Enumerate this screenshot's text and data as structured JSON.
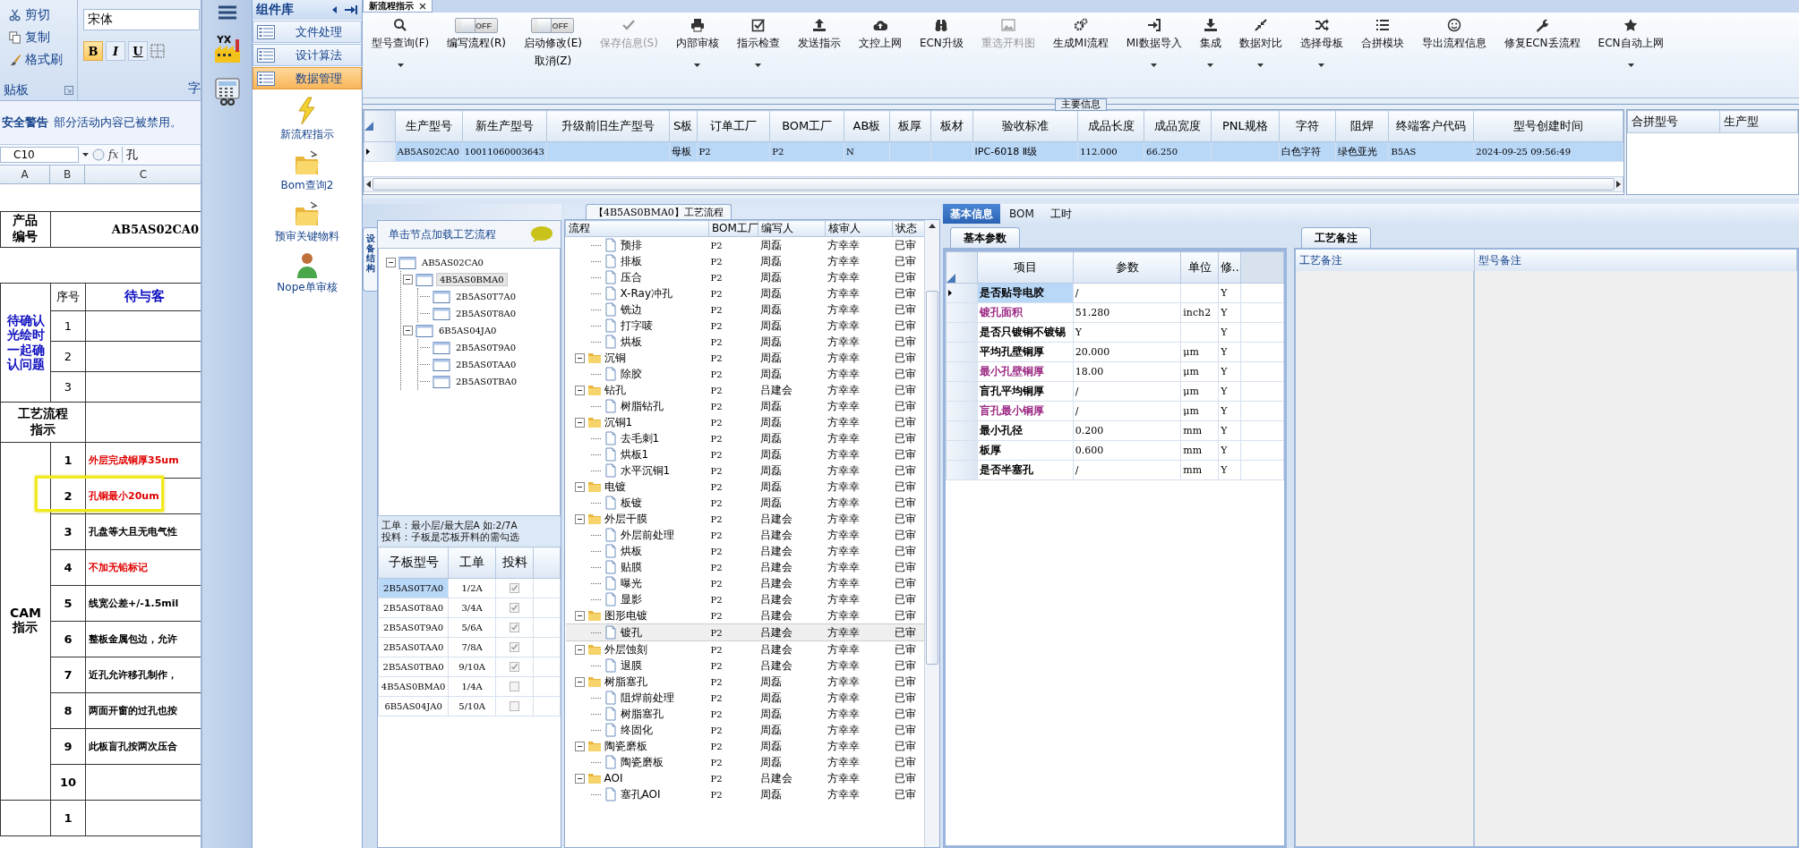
{
  "excel": {
    "clipboard": {
      "items": [
        "剪切",
        "复制",
        "格式刷"
      ],
      "label": "贴板"
    },
    "font": {
      "name": "宋体",
      "format_buttons": [
        "B",
        "I",
        "U"
      ],
      "label": "字"
    },
    "security": {
      "title": "安全警告",
      "message": "部分活动内容已被禁用。"
    },
    "name_box": "C10",
    "fx": "fx",
    "formula": "孔",
    "columns": [
      "A",
      "B",
      "C"
    ],
    "product": {
      "label": "产品编号",
      "value": "AB5AS02CA0"
    },
    "confirm": {
      "label": "待确认光绘时一起确认问题",
      "seq_header": "序号",
      "content_header": "待与客",
      "numbers": [
        "1",
        "2",
        "3"
      ]
    },
    "process_label": "工艺流程指示",
    "cam": {
      "label": "CAM指示",
      "items": [
        {
          "no": "1",
          "text": "外层完成铜厚35um",
          "emphasis": true,
          "highlighted": false
        },
        {
          "no": "2",
          "text": "孔铜最小20um",
          "emphasis": true,
          "highlighted": true
        },
        {
          "no": "3",
          "text": "孔盘等大且无电气性",
          "emphasis": false,
          "highlighted": false
        },
        {
          "no": "4",
          "text": "不加无铅标记",
          "emphasis": true,
          "highlighted": false
        },
        {
          "no": "5",
          "text": "线宽公差+/-1.5mil",
          "emphasis": false,
          "highlighted": false
        },
        {
          "no": "6",
          "text": "整板金属包边，允许",
          "emphasis": false,
          "highlighted": false
        },
        {
          "no": "7",
          "text": "近孔允许移孔制作，",
          "emphasis": false,
          "highlighted": false
        },
        {
          "no": "8",
          "text": "两面开窗的过孔也按",
          "emphasis": false,
          "highlighted": false
        },
        {
          "no": "9",
          "text": "此板盲孔按两次压合",
          "emphasis": false,
          "highlighted": false
        },
        {
          "no": "10",
          "highlighted": false
        }
      ]
    },
    "next_numbers": [
      "1"
    ]
  },
  "library": {
    "title": "组件库",
    "categories": [
      {
        "label": "文件处理",
        "selected": false
      },
      {
        "label": "设计算法",
        "selected": false
      },
      {
        "label": "数据管理",
        "selected": true
      }
    ],
    "tools": [
      "新流程指示",
      "Bom查询2",
      "预审关键物料",
      "Nope单审核"
    ]
  },
  "document_tab": {
    "title": "新流程指示"
  },
  "toolbar": [
    {
      "kind": "button",
      "label": "型号查询(F)",
      "dropdown": true,
      "disabled": false
    },
    {
      "kind": "toggle",
      "label": "编写流程(R)",
      "on": false,
      "state_text": "OFF"
    },
    {
      "kind": "toggle",
      "label": "启动修改(E)",
      "sublabel": "取消(Z)",
      "on": false,
      "state_text": "OFF"
    },
    {
      "kind": "button",
      "label": "保存信息(S)",
      "dropdown": false,
      "disabled": true
    },
    {
      "kind": "button",
      "label": "内部审核",
      "dropdown": true,
      "disabled": false
    },
    {
      "kind": "button",
      "label": "指示检查",
      "dropdown": true,
      "disabled": false
    },
    {
      "kind": "button",
      "label": "发送指示",
      "dropdown": false,
      "disabled": false
    },
    {
      "kind": "button",
      "label": "文控上网",
      "dropdown": false,
      "disabled": false
    },
    {
      "kind": "button",
      "label": "ECN升级",
      "dropdown": false,
      "disabled": false
    },
    {
      "kind": "button",
      "label": "重选开料图",
      "dropdown": false,
      "disabled": true
    },
    {
      "kind": "button",
      "label": "生成MI流程",
      "dropdown": false,
      "disabled": false
    },
    {
      "kind": "button",
      "label": "MI数据导入",
      "dropdown": true,
      "disabled": false
    },
    {
      "kind": "button",
      "label": "集成",
      "dropdown": true,
      "disabled": false
    },
    {
      "kind": "button",
      "label": "数据对比",
      "dropdown": true,
      "disabled": false
    },
    {
      "kind": "button",
      "label": "选择母板",
      "dropdown": true,
      "disabled": false
    },
    {
      "kind": "button",
      "label": "合拼模块",
      "dropdown": false,
      "disabled": false
    },
    {
      "kind": "button",
      "label": "导出流程信息",
      "dropdown": false,
      "disabled": false
    },
    {
      "kind": "button",
      "label": "修复ECN丢流程",
      "dropdown": false,
      "disabled": false
    },
    {
      "kind": "button",
      "label": "ECN自动上网",
      "dropdown": true,
      "disabled": false
    }
  ],
  "main_info": {
    "legend": "主要信息",
    "columns": [
      "生产型号",
      "新生产型号",
      "升级前旧生产型号",
      "S板",
      "订单工厂",
      "BOM工厂",
      "AB板",
      "板厚",
      "板材",
      "验收标准",
      "成品长度",
      "成品宽度",
      "PNL规格",
      "字符",
      "阻焊",
      "终端客户代码",
      "型号创建时间"
    ],
    "rows": [
      {
        "selected": true,
        "cells": [
          "AB5AS02CA0",
          "10011060003643",
          null,
          "母板",
          "P2",
          "P2",
          "N",
          null,
          null,
          "IPC-6018 Ⅱ级",
          "112.000",
          "66.250",
          null,
          "白色字符",
          "绿色亚光",
          "B5AS",
          "2024-09-25 09:56:49"
        ]
      }
    ],
    "side_columns": [
      "合拼型号",
      "生产型"
    ]
  },
  "structure": {
    "tab": "设备结构",
    "hint": "单击节点加载工艺流程",
    "tree": [
      {
        "label": "AB5AS02CA0",
        "expanded": true,
        "selected": false,
        "children": [
          {
            "label": "4B5AS0BMA0",
            "expanded": true,
            "selected": true,
            "children": [
              {
                "label": "2B5AS0T7A0",
                "selected": false
              },
              {
                "label": "2B5AS0T8A0",
                "selected": false
              }
            ]
          },
          {
            "label": "6B5AS04JA0",
            "expanded": true,
            "selected": false,
            "children": [
              {
                "label": "2B5AS0T9A0",
                "selected": false
              },
              {
                "label": "2B5AS0TAA0",
                "selected": false
              },
              {
                "label": "2B5AS0TBA0",
                "selected": false
              }
            ]
          }
        ]
      }
    ],
    "notes": [
      "工单：最小层/最大层A 如:2/7A",
      "投料：子板是芯板开料的需勾选"
    ],
    "columns": [
      "子板型号",
      "工单",
      "投料"
    ],
    "rows": [
      {
        "board": "2B5AS0T7A0",
        "order": "1/2A",
        "checked": true,
        "selected": true
      },
      {
        "board": "2B5AS0T8A0",
        "order": "3/4A",
        "checked": true,
        "selected": false
      },
      {
        "board": "2B5AS0T9A0",
        "order": "5/6A",
        "checked": true,
        "selected": false
      },
      {
        "board": "2B5AS0TAA0",
        "order": "7/8A",
        "checked": true,
        "selected": false
      },
      {
        "board": "2B5AS0TBA0",
        "order": "9/10A",
        "checked": true,
        "selected": false
      },
      {
        "board": "4B5AS0BMA0",
        "order": "1/4A",
        "checked": false,
        "selected": false
      },
      {
        "board": "6B5AS04JA0",
        "order": "5/10A",
        "checked": false,
        "selected": false
      }
    ]
  },
  "process": {
    "title": "【4B5AS0BMA0】工艺流程",
    "columns": [
      "流程",
      "BOM工厂",
      "编写人",
      "核审人",
      "状态"
    ],
    "groups": [
      {
        "children": [
          {
            "label": "预排",
            "bom": "P2",
            "writer": "周磊",
            "reviewer": "方幸幸",
            "status": "已审",
            "selected": false
          },
          {
            "label": "排板",
            "bom": "P2",
            "writer": "周磊",
            "reviewer": "方幸幸",
            "status": "已审",
            "selected": false
          },
          {
            "label": "压合",
            "bom": "P2",
            "writer": "周磊",
            "reviewer": "方幸幸",
            "status": "已审",
            "selected": false
          },
          {
            "label": "X-Ray冲孔",
            "bom": "P2",
            "writer": "周磊",
            "reviewer": "方幸幸",
            "status": "已审",
            "selected": false
          },
          {
            "label": "铣边",
            "bom": "P2",
            "writer": "周磊",
            "reviewer": "方幸幸",
            "status": "已审",
            "selected": false
          },
          {
            "label": "打字唛",
            "bom": "P2",
            "writer": "周磊",
            "reviewer": "方幸幸",
            "status": "已审",
            "selected": false
          },
          {
            "label": "烘板",
            "bom": "P2",
            "writer": "周磊",
            "reviewer": "方幸幸",
            "status": "已审",
            "selected": false
          }
        ]
      },
      {
        "label": "沉铜",
        "bom": "P2",
        "writer": "周磊",
        "reviewer": "方幸幸",
        "status": "已审",
        "selected": false,
        "expanded": true,
        "children": [
          {
            "label": "除胶",
            "bom": "P2",
            "writer": "周磊",
            "reviewer": "方幸幸",
            "status": "已审",
            "selected": false
          }
        ]
      },
      {
        "label": "钻孔",
        "bom": "P2",
        "writer": "吕建会",
        "reviewer": "方幸幸",
        "status": "已审",
        "selected": false,
        "expanded": true,
        "children": [
          {
            "label": "树脂钻孔",
            "bom": "P2",
            "writer": "周磊",
            "reviewer": "方幸幸",
            "status": "已审",
            "selected": false
          }
        ]
      },
      {
        "label": "沉铜1",
        "bom": "P2",
        "writer": "周磊",
        "reviewer": "方幸幸",
        "status": "已审",
        "selected": false,
        "expanded": true,
        "children": [
          {
            "label": "去毛刺1",
            "bom": "P2",
            "writer": "周磊",
            "reviewer": "方幸幸",
            "status": "已审",
            "selected": false
          },
          {
            "label": "烘板1",
            "bom": "P2",
            "writer": "周磊",
            "reviewer": "方幸幸",
            "status": "已审",
            "selected": false
          },
          {
            "label": "水平沉铜1",
            "bom": "P2",
            "writer": "周磊",
            "reviewer": "方幸幸",
            "status": "已审",
            "selected": false
          }
        ]
      },
      {
        "label": "电镀",
        "bom": "P2",
        "writer": "周磊",
        "reviewer": "方幸幸",
        "status": "已审",
        "selected": false,
        "expanded": true,
        "children": [
          {
            "label": "板镀",
            "bom": "P2",
            "writer": "周磊",
            "reviewer": "方幸幸",
            "status": "已审",
            "selected": false
          }
        ]
      },
      {
        "label": "外层干膜",
        "bom": "P2",
        "writer": "吕建会",
        "reviewer": "方幸幸",
        "status": "已审",
        "selected": false,
        "expanded": true,
        "children": [
          {
            "label": "外层前处理",
            "bom": "P2",
            "writer": "吕建会",
            "reviewer": "方幸幸",
            "status": "已审",
            "selected": false
          },
          {
            "label": "烘板",
            "bom": "P2",
            "writer": "吕建会",
            "reviewer": "方幸幸",
            "status": "已审",
            "selected": false
          },
          {
            "label": "贴膜",
            "bom": "P2",
            "writer": "吕建会",
            "reviewer": "方幸幸",
            "status": "已审",
            "selected": false
          },
          {
            "label": "曝光",
            "bom": "P2",
            "writer": "吕建会",
            "reviewer": "方幸幸",
            "status": "已审",
            "selected": false
          },
          {
            "label": "显影",
            "bom": "P2",
            "writer": "吕建会",
            "reviewer": "方幸幸",
            "status": "已审",
            "selected": false
          }
        ]
      },
      {
        "label": "图形电镀",
        "bom": "P2",
        "writer": "吕建会",
        "reviewer": "方幸幸",
        "status": "已审",
        "selected": false,
        "expanded": true,
        "children": [
          {
            "label": "镀孔",
            "bom": "P2",
            "writer": "吕建会",
            "reviewer": "方幸幸",
            "status": "已审",
            "selected": true
          }
        ]
      },
      {
        "label": "外层蚀刻",
        "bom": "P2",
        "writer": "吕建会",
        "reviewer": "方幸幸",
        "status": "已审",
        "selected": false,
        "expanded": true,
        "children": [
          {
            "label": "退膜",
            "bom": "P2",
            "writer": "吕建会",
            "reviewer": "方幸幸",
            "status": "已审",
            "selected": false
          }
        ]
      },
      {
        "label": "树脂塞孔",
        "bom": "P2",
        "writer": "周磊",
        "reviewer": "方幸幸",
        "status": "已审",
        "selected": false,
        "expanded": true,
        "children": [
          {
            "label": "阻焊前处理",
            "bom": "P2",
            "writer": "周磊",
            "reviewer": "方幸幸",
            "status": "已审",
            "selected": false
          },
          {
            "label": "树脂塞孔",
            "bom": "P2",
            "writer": "周磊",
            "reviewer": "方幸幸",
            "status": "已审",
            "selected": false
          },
          {
            "label": "终固化",
            "bom": "P2",
            "writer": "周磊",
            "reviewer": "方幸幸",
            "status": "已审",
            "selected": false
          }
        ]
      },
      {
        "label": "陶瓷磨板",
        "bom": "P2",
        "writer": "周磊",
        "reviewer": "方幸幸",
        "status": "已审",
        "selected": false,
        "expanded": true,
        "children": [
          {
            "label": "陶瓷磨板",
            "bom": "P2",
            "writer": "周磊",
            "reviewer": "方幸幸",
            "status": "已审",
            "selected": false
          }
        ]
      },
      {
        "label": "AOI",
        "bom": "P2",
        "writer": "吕建会",
        "reviewer": "方幸幸",
        "status": "已审",
        "selected": false,
        "expanded": true,
        "children": [
          {
            "label": "塞孔AOI",
            "bom": "P2",
            "writer": "周磊",
            "reviewer": "方幸幸",
            "status": "已审",
            "selected": false
          }
        ]
      }
    ]
  },
  "details": {
    "tabs": [
      {
        "label": "基本信息",
        "selected": true
      },
      {
        "label": "BOM",
        "selected": false
      },
      {
        "label": "工时",
        "selected": false
      }
    ],
    "params_tab": "基本参数",
    "columns": [
      "项目",
      "参数",
      "单位",
      "修.."
    ],
    "rows": [
      {
        "item": "是否贴导电胶",
        "value": "/",
        "flag": "Y",
        "color": "#000000",
        "selected": true
      },
      {
        "item": "镀孔面积",
        "value": "51.280",
        "unit": "inch2",
        "flag": "Y",
        "color": "#9c2a84",
        "selected": false
      },
      {
        "item": "是否只镀铜不镀锡",
        "value": "Y",
        "flag": "Y",
        "color": "#000000",
        "selected": false
      },
      {
        "item": "平均孔壁铜厚",
        "value": "20.000",
        "unit": "μm",
        "flag": "Y",
        "color": "#000000",
        "selected": false
      },
      {
        "item": "最小孔壁铜厚",
        "value": "18.00",
        "unit": "μm",
        "flag": "Y",
        "color": "#9c2a84",
        "selected": false
      },
      {
        "item": "盲孔平均铜厚",
        "value": "/",
        "unit": "μm",
        "flag": "Y",
        "color": "#000000",
        "selected": false
      },
      {
        "item": "盲孔最小铜厚",
        "value": "/",
        "unit": "μm",
        "flag": "Y",
        "color": "#9c2a84",
        "selected": false
      },
      {
        "item": "最小孔径",
        "value": "0.200",
        "unit": "mm",
        "flag": "Y",
        "color": "#000000",
        "selected": false
      },
      {
        "item": "板厚",
        "value": "0.600",
        "unit": "mm",
        "flag": "Y",
        "color": "#000000",
        "selected": false
      },
      {
        "item": "是否半塞孔",
        "value": "/",
        "unit": "mm",
        "flag": "Y",
        "color": "#000000",
        "selected": false
      }
    ],
    "notes_tab": "工艺备注",
    "notes_columns": [
      "工艺备注",
      "型号备注"
    ]
  }
}
